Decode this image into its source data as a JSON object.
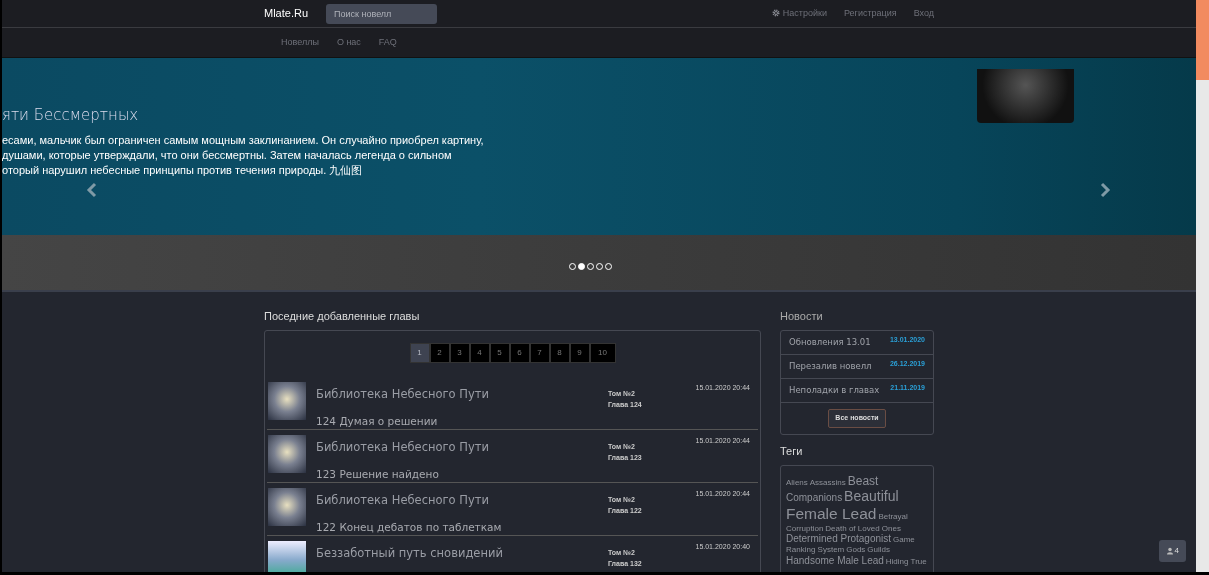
{
  "navbar": {
    "brand": "Mlate.Ru",
    "search": {
      "placeholder": "Поиск новелл"
    },
    "right_links": [
      {
        "label": "Настройки",
        "kind": "settings"
      },
      {
        "label": "Регистрация",
        "kind": "plain"
      },
      {
        "label": "Вход",
        "kind": "plain"
      }
    ]
  },
  "subnav": {
    "links": [
      "Новеллы",
      "О нас",
      "FAQ"
    ]
  },
  "carousel": {
    "title": "яти Бессмертных",
    "description_lines": [
      "есами, мальчик был ограничен самым мощным заклинанием. Он случайно приобрел картину,",
      "душами, которые утверждали, что они бессмертны. Затем началась легенда о сильном",
      "оторый нарушил небесные принципы против течения природы. 九仙图"
    ],
    "indicators": [
      {
        "selected": false
      },
      {
        "selected": true
      },
      {
        "selected": false
      },
      {
        "selected": false
      },
      {
        "selected": false
      }
    ]
  },
  "latest": {
    "heading": "Поседние добавленные главы",
    "pagination": [
      {
        "label": "1",
        "selected": true
      },
      {
        "label": "2",
        "selected": false
      },
      {
        "label": "3",
        "selected": false
      },
      {
        "label": "4",
        "selected": false
      },
      {
        "label": "5",
        "selected": false
      },
      {
        "label": "6",
        "selected": false
      },
      {
        "label": "7",
        "selected": false
      },
      {
        "label": "8",
        "selected": false
      },
      {
        "label": "9",
        "selected": false
      },
      {
        "label": "10",
        "selected": false
      }
    ],
    "chapters": [
      {
        "title": "Библиотека Небесного Пути",
        "chapter_title": "124 Думая о решении",
        "volume": "Том №2",
        "chapter": "Глава 124",
        "date": "15.01.2020 20:44",
        "kind": "dark"
      },
      {
        "title": "Библиотека Небесного Пути",
        "chapter_title": "123 Решение найдено",
        "volume": "Том №2",
        "chapter": "Глава 123",
        "date": "15.01.2020 20:44",
        "kind": "dark"
      },
      {
        "title": "Библиотека Небесного Пути",
        "chapter_title": "122 Конец дебатов по таблеткам",
        "volume": "Том №2",
        "chapter": "Глава 122",
        "date": "15.01.2020 20:44",
        "kind": "dark"
      },
      {
        "title": "Беззаботный путь сновидений",
        "volume": "Том №2",
        "chapter": "Глава 132",
        "date": "15.01.2020 20:40",
        "kind": "light"
      }
    ]
  },
  "news": {
    "heading": "Новости",
    "items": [
      {
        "title": "Обновления 13.01",
        "date": "13.01.2020"
      },
      {
        "title": "Перезалив новелл",
        "date": "26.12.2019"
      },
      {
        "title": "Неполадки в главах",
        "date": "21.11.2019"
      }
    ],
    "all_button": "Все новости"
  },
  "tags": {
    "heading": "Теги",
    "items": [
      {
        "label": "Aliens",
        "kind": "s"
      },
      {
        "label": "Assassins",
        "kind": "s"
      },
      {
        "label": "Beast",
        "kind": "l"
      },
      {
        "label": "Companions",
        "kind": "m"
      },
      {
        "label": "Beautiful",
        "kind": "xl"
      },
      {
        "label": "Female Lead",
        "kind": "xxl"
      },
      {
        "label": "Betrayal",
        "kind": "s"
      },
      {
        "label": "Corruption",
        "kind": "s"
      },
      {
        "label": "Death of Loved Ones",
        "kind": "s"
      },
      {
        "label": "Determined Protagonist",
        "kind": "m"
      },
      {
        "label": "Game",
        "kind": "s"
      },
      {
        "label": "Ranking System",
        "kind": "s"
      },
      {
        "label": "Gods",
        "kind": "s"
      },
      {
        "label": "Guilds",
        "kind": "s"
      },
      {
        "label": "Handsome Male Lead",
        "kind": "m"
      },
      {
        "label": "Hiding True",
        "kind": "s"
      }
    ]
  },
  "online_badge": {
    "count": "4"
  }
}
